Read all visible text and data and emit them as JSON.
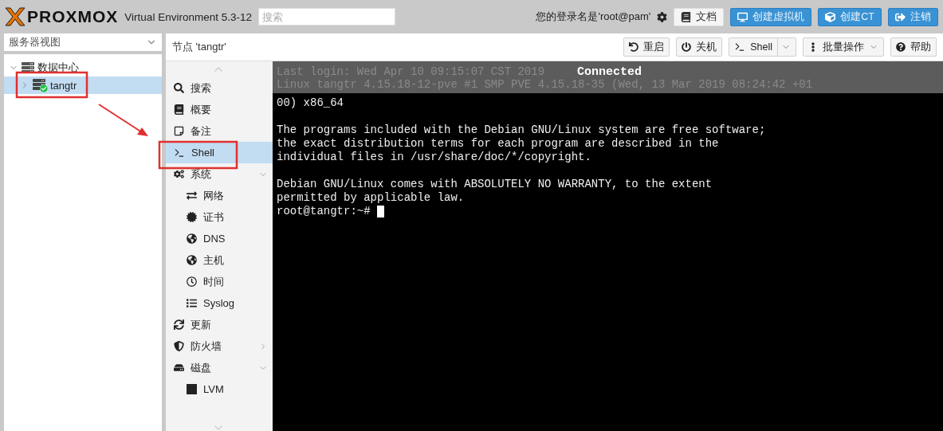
{
  "header": {
    "logo": "PROXMOX",
    "product": "Virtual Environment 5.3-12",
    "search": {
      "placeholder": "搜索"
    },
    "user": "您的登录名是'root@pam'",
    "buttons": [
      {
        "label": "文档",
        "kind": "plain"
      },
      {
        "label": "创建虚拟机",
        "kind": "primary"
      },
      {
        "label": "创建CT",
        "kind": "primary"
      },
      {
        "label": "注销",
        "kind": "primary"
      }
    ]
  },
  "view_selector": {
    "value": "服务器视图"
  },
  "tree": [
    {
      "label": "数据中心",
      "expanded": true,
      "selected": false,
      "children": [
        {
          "label": "tangtr",
          "expanded": false,
          "selected": true
        }
      ]
    }
  ],
  "panel": {
    "title": "节点 'tangtr'",
    "toolbar": [
      {
        "label": "重启",
        "kind": "button"
      },
      {
        "label": "关机",
        "kind": "button"
      },
      {
        "label": "Shell",
        "kind": "split"
      },
      {
        "label": "批量操作",
        "kind": "menu"
      },
      {
        "label": "帮助",
        "kind": "button"
      }
    ]
  },
  "nav": [
    {
      "label": "搜索",
      "selected": false
    },
    {
      "label": "概要",
      "selected": false
    },
    {
      "label": "备注",
      "selected": false
    },
    {
      "label": "Shell",
      "selected": true
    },
    {
      "label": "系统",
      "selected": false,
      "expanded": true,
      "children": [
        {
          "label": "网络",
          "selected": false
        },
        {
          "label": "证书",
          "selected": false
        },
        {
          "label": "DNS",
          "selected": false
        },
        {
          "label": "主机",
          "selected": false
        },
        {
          "label": "时间",
          "selected": false
        },
        {
          "label": "Syslog",
          "selected": false
        }
      ]
    },
    {
      "label": "更新",
      "selected": false
    },
    {
      "label": "防火墙",
      "selected": false,
      "expanded": false
    },
    {
      "label": "磁盘",
      "selected": false,
      "expanded": true,
      "children": [
        {
          "label": "LVM",
          "selected": false
        }
      ]
    }
  ],
  "terminal": {
    "status": "Connected",
    "behind_status": [
      "Last login: Wed Apr 10 09:15:07 CST 2019",
      "Linux tangtr 4.15.18-12-pve #1 SMP PVE 4.15.18-35 (Wed, 13 Mar 2019 08:24:42 +01"
    ],
    "paragraphs": [
      [
        "00) x86_64"
      ],
      [
        "The programs included with the Debian GNU/Linux system are free software;",
        "the exact distribution terms for each program are described in the",
        "individual files in /usr/share/doc/*/copyright."
      ],
      [
        "Debian GNU/Linux comes with ABSOLUTELY NO WARRANTY, to the extent",
        "permitted by applicable law."
      ]
    ],
    "prompt": "root@tangtr:~#"
  }
}
